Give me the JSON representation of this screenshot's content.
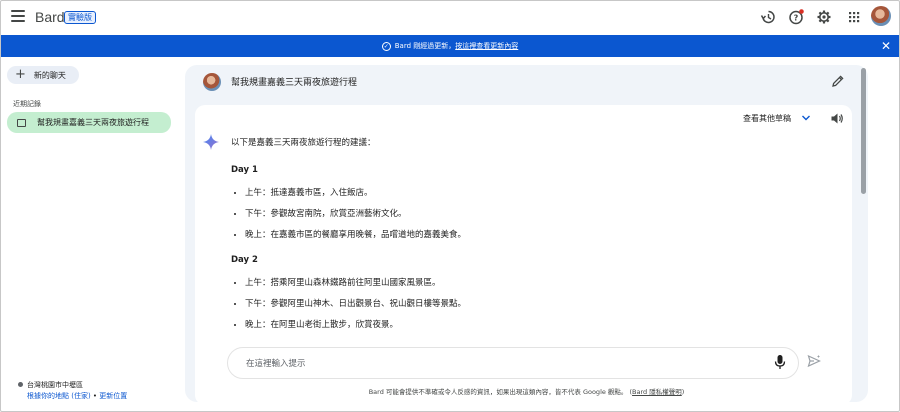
{
  "header": {
    "brand": "Bard",
    "badge": "實驗版"
  },
  "banner": {
    "text_prefix": "Bard 剛經過更新，",
    "link": "按這裡查看更新內容"
  },
  "sidebar": {
    "new_chat": "新的聊天",
    "recent_label": "近期記錄",
    "recent_items": [
      {
        "label": "幫我規畫嘉義三天兩夜旅遊行程"
      }
    ],
    "location": {
      "place": "台灣桃園市中壢區",
      "link_ip": "根據你的地點 (住家)",
      "separator": " • ",
      "link_update": "更新位置"
    }
  },
  "conversation": {
    "question": "幫我規畫嘉義三天兩夜旅遊行程",
    "drafts_label": "查看其他草稿",
    "intro": "以下是嘉義三天兩夜旅遊行程的建議：",
    "days": [
      {
        "title": "Day 1",
        "items": [
          "上午：抵達嘉義市區，入住飯店。",
          "下午：參觀故宮南院，欣賞亞洲藝術文化。",
          "晚上：在嘉義市區的餐廳享用晚餐，品嚐道地的嘉義美食。"
        ]
      },
      {
        "title": "Day 2",
        "items": [
          "上午：搭乘阿里山森林鐵路前往阿里山國家風景區。",
          "下午：參觀阿里山神木、日出觀景台、祝山觀日樓等景點。",
          "晚上：在阿里山老街上散步，欣賞夜景。"
        ]
      }
    ]
  },
  "prompt": {
    "placeholder": "在這裡輸入提示"
  },
  "footer": {
    "disclaimer": "Bard 可能會提供不準確或令人反感的資訊，如果出現這類內容，皆不代表 Google 觀點。",
    "privacy_link": "Bard 隱私權聲明"
  }
}
